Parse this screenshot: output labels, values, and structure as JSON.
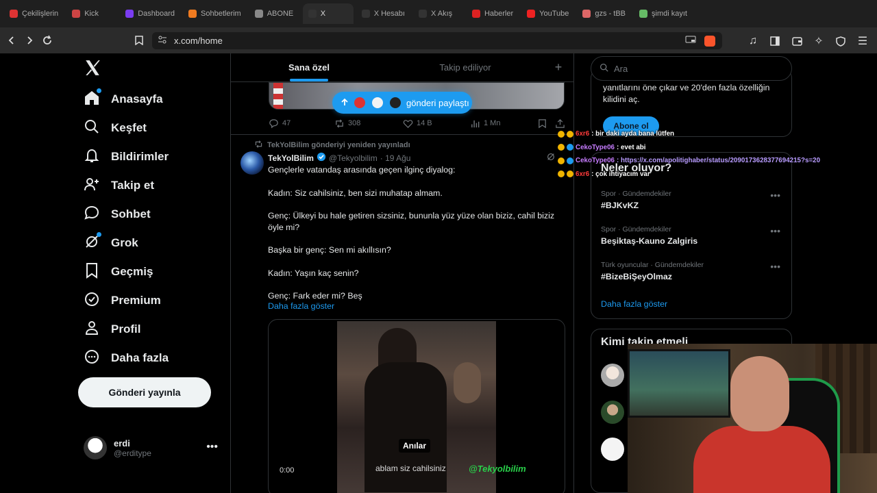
{
  "browser": {
    "tabs": [
      {
        "label": "Çekilişlerin",
        "color": "#d33"
      },
      {
        "label": "Kick",
        "color": "#c44"
      },
      {
        "label": "Dashboard",
        "color": "#7a3cf0"
      },
      {
        "label": "Sohbetlerim",
        "color": "#f07b20"
      },
      {
        "label": "ABONE",
        "color": "#888"
      },
      {
        "label": "X",
        "color": "#333",
        "active": true
      },
      {
        "label": "X Hesabı",
        "color": "#333"
      },
      {
        "label": "X Akış",
        "color": "#333"
      },
      {
        "label": "Haberler",
        "color": "#d22"
      },
      {
        "label": "YouTube",
        "color": "#e22"
      },
      {
        "label": "gzs - tBB",
        "color": "#d66"
      },
      {
        "label": "şimdi kayıt",
        "color": "#6b6"
      }
    ],
    "url": "x.com/home"
  },
  "nav": {
    "items": [
      {
        "label": "Anasayfa",
        "icon": "home-icon",
        "notify": true
      },
      {
        "label": "Keşfet",
        "icon": "search-icon"
      },
      {
        "label": "Bildirimler",
        "icon": "bell-icon"
      },
      {
        "label": "Takip et",
        "icon": "follow-icon"
      },
      {
        "label": "Sohbet",
        "icon": "chat-icon"
      },
      {
        "label": "Grok",
        "icon": "grok-icon",
        "notify": true
      },
      {
        "label": "Geçmiş",
        "icon": "bookmark-icon"
      },
      {
        "label": "Premium",
        "icon": "premium-icon"
      },
      {
        "label": "Profil",
        "icon": "profile-icon"
      },
      {
        "label": "Daha fazla",
        "icon": "more-icon"
      }
    ],
    "post_button": "Gönderi yayınla",
    "user": {
      "name": "erdi",
      "handle": "@erditype"
    }
  },
  "main": {
    "tabs": [
      "Sana özel",
      "Takip ediliyor"
    ],
    "new_posts_pill": "gönderi paylaştı",
    "prev_actions": {
      "replies": "47",
      "reposts": "308",
      "likes": "14 B",
      "views": "1 Mn"
    },
    "tweet": {
      "reposted_by": "TekYolBilim gönderiyi yeniden yayınladı",
      "name": "TekYolBilim",
      "handle": "@Tekyolbilim",
      "date": "· 19 Ağu",
      "lines": [
        "Gençlerle vatandaş arasında geçen ilginç diyalog:",
        "Kadın: Siz cahilsiniz, ben sizi muhatap almam.",
        "Genç: Ülkeyi bu hale getiren sizsiniz, bununla yüz yüze olan biziz, cahil biziz öyle mi?",
        "Başka bir genç: Sen mi akıllısın?",
        "Kadın: Yaşın kaç senin?",
        "Genç: Fark eder mi? Beş"
      ],
      "show_more": "Daha fazla göster",
      "video": {
        "caption": "Anılar",
        "subtitle": "ablam siz cahilsiniz",
        "watermark": "@Tekyolbilim",
        "time": "0:00"
      }
    }
  },
  "right": {
    "search_placeholder": "Ara",
    "premium_text": "yanıtlarını öne çıkar ve 20'den fazla özelliğin kilidini aç.",
    "premium_button": "Abone ol",
    "trends_title": "Neler oluyor?",
    "trends": [
      {
        "category": "Spor · Gündemdekiler",
        "name": "#BJKvKZ"
      },
      {
        "category": "Spor · Gündemdekiler",
        "name": "Beşiktaş-Kauno Zalgiris"
      },
      {
        "category": "Türk oyuncular · Gündemdekiler",
        "name": "#BizeBiŞeyOlmaz"
      }
    ],
    "trends_more": "Daha fazla göster",
    "who_title": "Kimi takip etmeli"
  },
  "chat": [
    {
      "user": "6xr6",
      "color": "#ff3b3b",
      "msg": ": bir daki ayda bana lütfen"
    },
    {
      "user": "CekoType06",
      "color": "#c77dff",
      "msg": ": evet abi"
    },
    {
      "user": "CekoType06",
      "color": "#c77dff",
      "msg": ": https://x.com/apolitighaber/status/2090173628377694215?s=20",
      "link": true
    },
    {
      "user": "6xr6",
      "color": "#ff3b3b",
      "msg": ": çok ihtiyacım var"
    }
  ],
  "colors": {
    "accent": "#1d9bf0",
    "bg": "#000000",
    "border": "#2f3336",
    "muted": "#71767b"
  }
}
